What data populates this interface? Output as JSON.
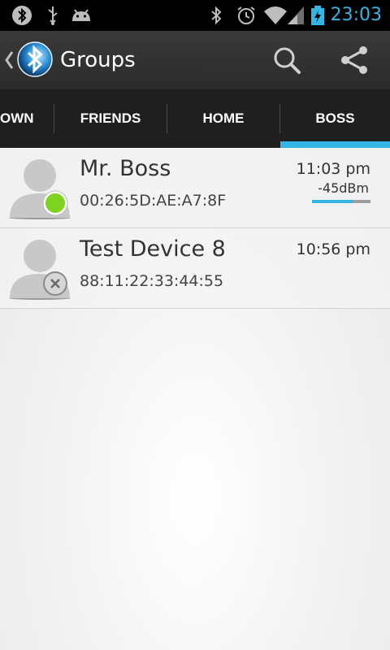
{
  "status_bar": {
    "time": "23:03",
    "icons": [
      "bluetooth-notification-icon",
      "usb-icon",
      "android-icon",
      "bluetooth-icon",
      "alarm-icon",
      "wifi-icon",
      "signal-icon",
      "battery-charging-icon"
    ]
  },
  "action_bar": {
    "title": "Groups",
    "icons": [
      "up-caret-icon",
      "bluetooth-app-logo-icon",
      "search-icon",
      "share-icon"
    ]
  },
  "tabs": [
    {
      "label": "OWN"
    },
    {
      "label": "FRIENDS"
    },
    {
      "label": "HOME"
    },
    {
      "label": "BOSS",
      "selected": true
    }
  ],
  "devices": [
    {
      "name": "Mr. Boss",
      "mac": "00:26:5D:AE:A7:8F",
      "time": "11:03 pm",
      "rssi": "-45dBm",
      "signal_level": 0.7,
      "status": "online",
      "status_color": "#7ed321"
    },
    {
      "name": "Test Device 8",
      "mac": "88:11:22:33:44:55",
      "time": "10:56 pm",
      "status": "offline"
    }
  ],
  "colors": {
    "accent": "#33b5e5",
    "actionbar": "#333333",
    "tabbar": "#1f1f1f"
  }
}
